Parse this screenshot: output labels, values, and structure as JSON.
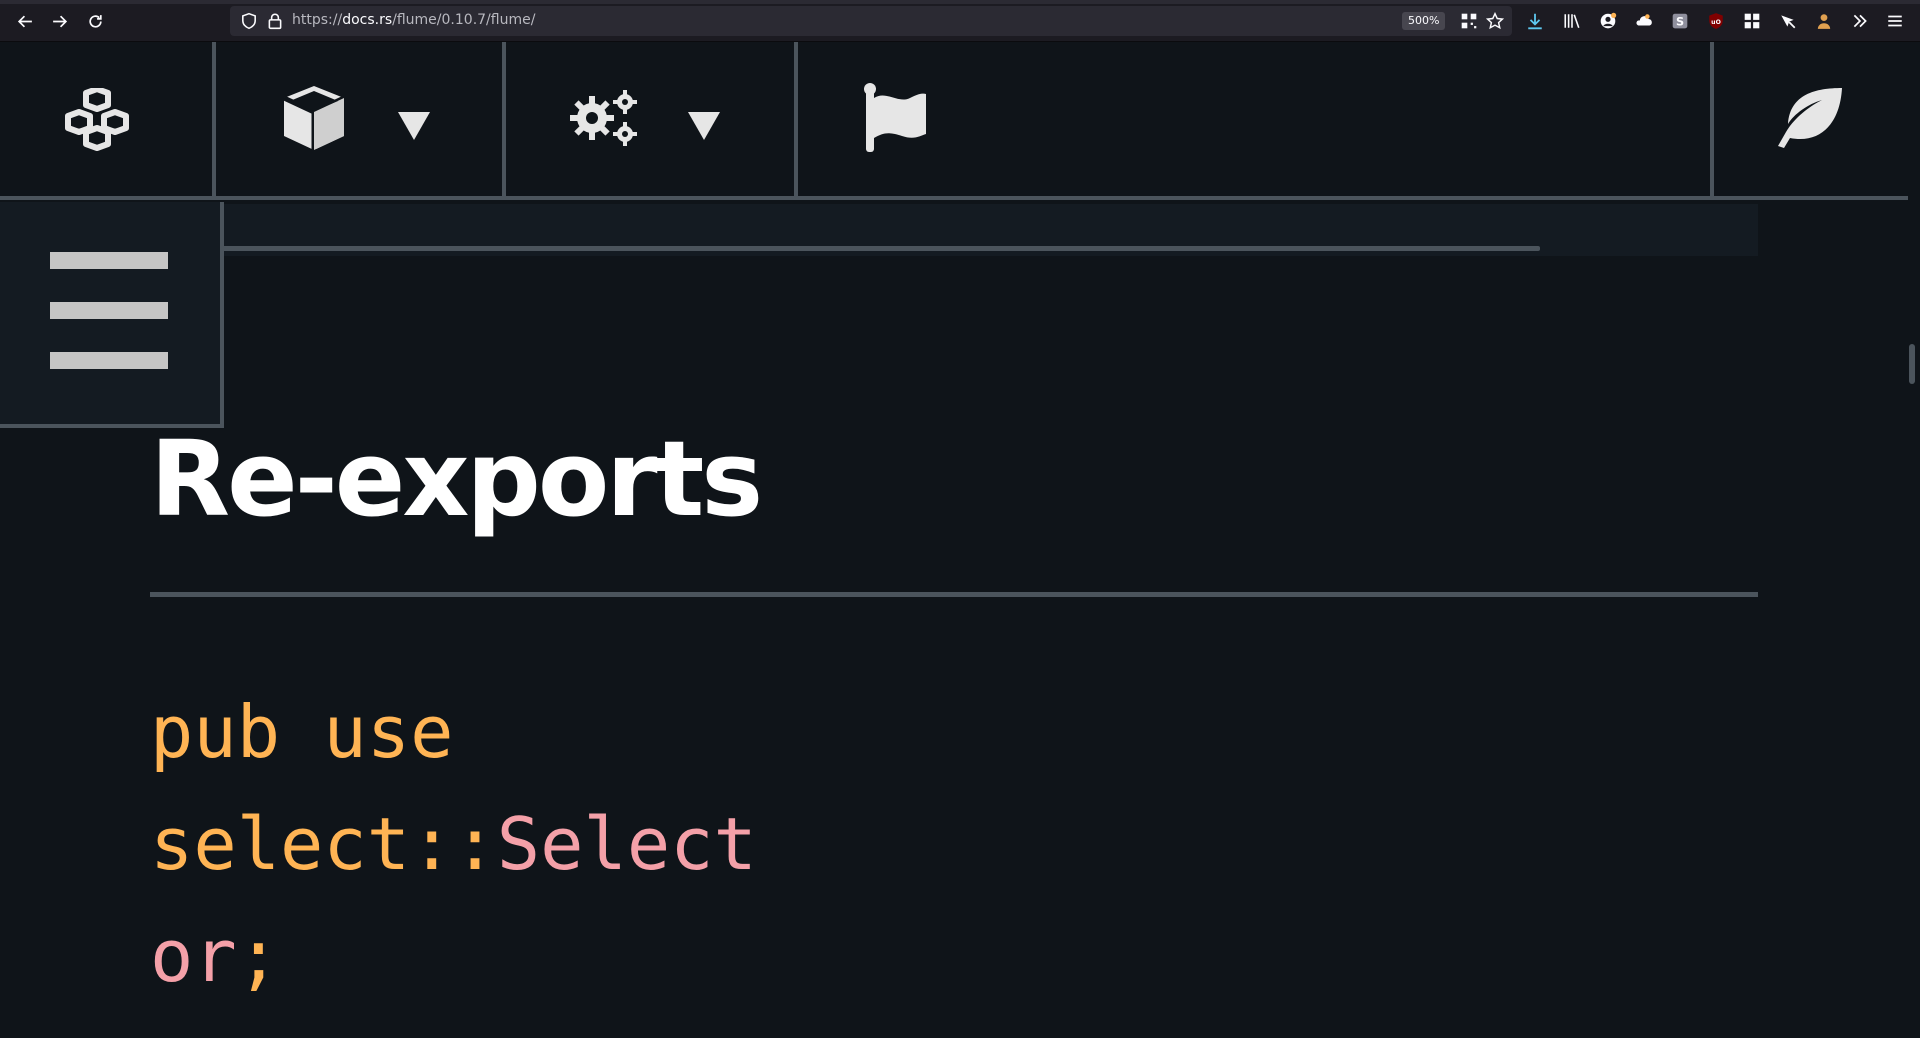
{
  "browser": {
    "url_scheme": "https://",
    "url_host": "docs.rs",
    "url_path": "/flume/0.10.7/flume/",
    "zoom": "500%"
  },
  "docs_nav": {
    "icons": [
      "cubes-icon",
      "cube-icon",
      "gears-icon",
      "flag-icon",
      "leaf-icon"
    ]
  },
  "content": {
    "heading": "Re-exports",
    "code": {
      "line1": {
        "keyword": "pub use"
      },
      "line2": {
        "path": "select::",
        "ident": "Select"
      },
      "line3": {
        "ident": "or",
        "punct": ";"
      }
    }
  },
  "colors": {
    "background": "#0f1419",
    "keyword": "#ffb454",
    "ident": "#ff7f98"
  }
}
